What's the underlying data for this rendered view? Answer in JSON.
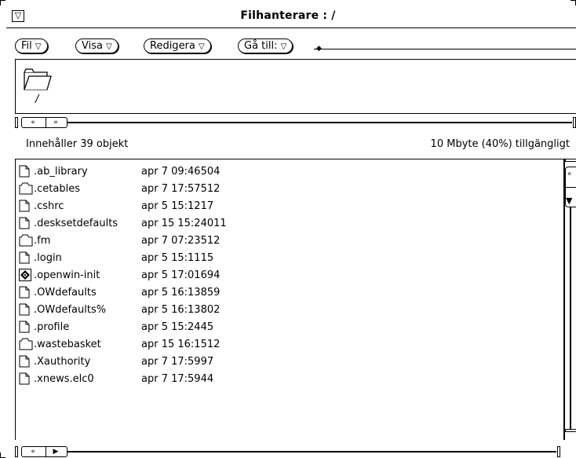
{
  "window": {
    "title": "Filhanterare : /",
    "menu_glyph": "▽"
  },
  "menubar": {
    "items": [
      {
        "label": "Fil",
        "arrow": "▽"
      },
      {
        "label": "Visa",
        "arrow": "▽"
      },
      {
        "label": "Redigera",
        "arrow": "▽"
      },
      {
        "label": "Gå till:",
        "arrow": "▽"
      }
    ],
    "goto_value": ""
  },
  "path_pane": {
    "icon": "folder-icon",
    "label": "/"
  },
  "status": {
    "left": "Innehåller 39 objekt",
    "right": "10 Mbyte (40%) tillgängligt"
  },
  "files": [
    {
      "name": ".ab_library",
      "date": "apr  7 09:46",
      "size": "504",
      "icon": "document-icon"
    },
    {
      "name": ".cetables",
      "date": "apr  7 17:57",
      "size": "512",
      "icon": "folder-icon"
    },
    {
      "name": ".cshrc",
      "date": "apr  5 15:12",
      "size": "17",
      "icon": "document-icon"
    },
    {
      "name": ".desksetdefaults",
      "date": "apr 15 15:24",
      "size": "011",
      "icon": "document-icon"
    },
    {
      "name": ".fm",
      "date": "apr  7 07:23",
      "size": "512",
      "icon": "folder-icon"
    },
    {
      "name": ".login",
      "date": "apr  5 15:11",
      "size": "15",
      "icon": "document-icon"
    },
    {
      "name": ".openwin-init",
      "date": "apr  5 17:01",
      "size": "694",
      "icon": "application-icon"
    },
    {
      "name": ".OWdefaults",
      "date": "apr  5 16:13",
      "size": "859",
      "icon": "document-icon"
    },
    {
      "name": ".OWdefaults%",
      "date": "apr  5 16:13",
      "size": "802",
      "icon": "document-icon"
    },
    {
      "name": ".profile",
      "date": "apr  5 15:24",
      "size": "45",
      "icon": "document-icon"
    },
    {
      "name": ".wastebasket",
      "date": "apr 15 16:15",
      "size": "12",
      "icon": "folder-icon"
    },
    {
      "name": ".Xauthority",
      "date": "apr  7 17:59",
      "size": "97",
      "icon": "document-icon"
    },
    {
      "name": ".xnews.elc0",
      "date": "apr  7 17:59",
      "size": "44",
      "icon": "document-icon"
    }
  ],
  "scrollbar_glyphs": {
    "left": "«",
    "right": "»",
    "right_filled": "▶",
    "up": "«",
    "down": "▼"
  }
}
